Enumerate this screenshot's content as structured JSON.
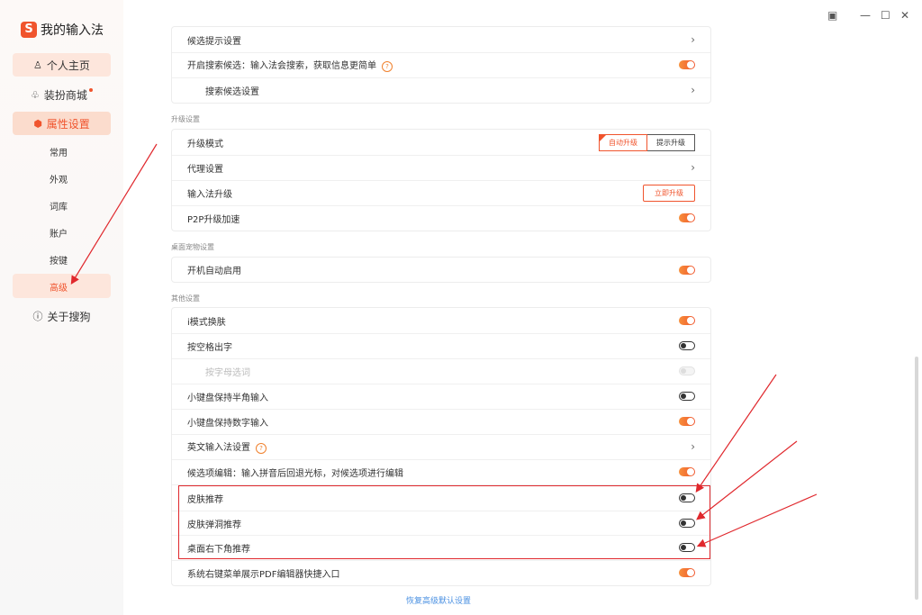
{
  "app": {
    "logo_letter": "S",
    "name": "我的输入法"
  },
  "sidebar": {
    "items": [
      {
        "label": "个人主页",
        "icon": "user-icon"
      },
      {
        "label": "装扮商城",
        "icon": "shirt-icon"
      },
      {
        "label": "属性设置",
        "icon": "settings-icon"
      }
    ],
    "subitems": [
      "常用",
      "外观",
      "词库",
      "账户",
      "按键",
      "高级"
    ],
    "about": "关于搜狗"
  },
  "top_group": {
    "rows": [
      {
        "label": "候选提示设置",
        "control": "chevron"
      },
      {
        "label": "开启搜索候选：输入法会搜索，获取信息更简单",
        "control": "toggle",
        "state": "on",
        "help": true
      },
      {
        "label": "搜索候选设置",
        "control": "chevron"
      }
    ]
  },
  "upgrade": {
    "section_title": "升级设置",
    "mode_label": "升级模式",
    "mode_options": [
      "自动升级",
      "提示升级"
    ],
    "selected_mode": "自动升级",
    "proxy_label": "代理设置",
    "ime_upgrade_label": "输入法升级",
    "upgrade_now": "立即升级",
    "p2p_label": "P2P升级加速"
  },
  "desktop_pet": {
    "section_title": "桌面宠物设置",
    "autostart_label": "开机自动启用"
  },
  "other": {
    "section_title": "其他设置",
    "rows": [
      {
        "label": "i模式换肤",
        "state": "on"
      },
      {
        "label": "按空格出字",
        "state": "off"
      },
      {
        "label": "按字母选词",
        "state": "disabled"
      },
      {
        "label": "小键盘保持半角输入",
        "state": "off"
      },
      {
        "label": "小键盘保持数字输入",
        "state": "on"
      },
      {
        "label": "英文输入法设置",
        "control": "chevron",
        "help": true
      },
      {
        "label": "候选项编辑：输入拼音后回退光标，对候选项进行编辑",
        "state": "on"
      },
      {
        "label": "皮肤推荐",
        "state": "off"
      },
      {
        "label": "皮肤弹洞推荐",
        "state": "off"
      },
      {
        "label": "桌面右下角推荐",
        "state": "off"
      },
      {
        "label": "系统右键菜单展示PDF编辑器快捷入口",
        "state": "on"
      }
    ]
  },
  "restore_link": "恢复高级默认设置",
  "colors": {
    "accent": "#f0542d",
    "highlight_box": "#e0282d",
    "link": "#4a90e2"
  }
}
